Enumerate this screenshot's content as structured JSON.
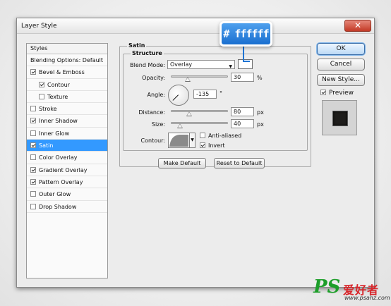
{
  "window": {
    "title": "Layer Style",
    "close_glyph": "✕"
  },
  "styles_list": {
    "header": "Styles",
    "items": [
      {
        "label": "Blending Options: Default",
        "has_checkbox": false,
        "checked": false,
        "indent": false,
        "selected": false
      },
      {
        "label": "Bevel & Emboss",
        "has_checkbox": true,
        "checked": true,
        "indent": false,
        "selected": false
      },
      {
        "label": "Contour",
        "has_checkbox": true,
        "checked": true,
        "indent": true,
        "selected": false
      },
      {
        "label": "Texture",
        "has_checkbox": true,
        "checked": false,
        "indent": true,
        "selected": false
      },
      {
        "label": "Stroke",
        "has_checkbox": true,
        "checked": false,
        "indent": false,
        "selected": false
      },
      {
        "label": "Inner Shadow",
        "has_checkbox": true,
        "checked": true,
        "indent": false,
        "selected": false
      },
      {
        "label": "Inner Glow",
        "has_checkbox": true,
        "checked": false,
        "indent": false,
        "selected": false
      },
      {
        "label": "Satin",
        "has_checkbox": true,
        "checked": true,
        "indent": false,
        "selected": true
      },
      {
        "label": "Color Overlay",
        "has_checkbox": true,
        "checked": false,
        "indent": false,
        "selected": false
      },
      {
        "label": "Gradient Overlay",
        "has_checkbox": true,
        "checked": true,
        "indent": false,
        "selected": false
      },
      {
        "label": "Pattern Overlay",
        "has_checkbox": true,
        "checked": true,
        "indent": false,
        "selected": false
      },
      {
        "label": "Outer Glow",
        "has_checkbox": true,
        "checked": false,
        "indent": false,
        "selected": false
      },
      {
        "label": "Drop Shadow",
        "has_checkbox": true,
        "checked": false,
        "indent": false,
        "selected": false
      }
    ]
  },
  "satin": {
    "group_title": "Satin",
    "structure_title": "Structure",
    "blend_mode": {
      "label": "Blend Mode:",
      "value": "Overlay",
      "color": "#ffffff"
    },
    "opacity": {
      "label": "Opacity:",
      "value": "30",
      "unit": "%",
      "level": 0.3
    },
    "angle": {
      "label": "Angle:",
      "value": "-135",
      "unit": "°"
    },
    "distance": {
      "label": "Distance:",
      "value": "80",
      "unit": "px",
      "level": 0.32
    },
    "size": {
      "label": "Size:",
      "value": "40",
      "unit": "px",
      "level": 0.16
    },
    "contour": {
      "label": "Contour:"
    },
    "anti_aliased": {
      "label": "Anti-aliased",
      "checked": false
    },
    "invert": {
      "label": "Invert",
      "checked": true
    },
    "make_default": "Make Default",
    "reset_default": "Reset to Default"
  },
  "buttons": {
    "ok": "OK",
    "cancel": "Cancel",
    "new_style": "New Style..."
  },
  "preview": {
    "label": "Preview",
    "checked": true
  },
  "callout": {
    "text": "# ffffff",
    "color": "#2a84e4"
  },
  "watermark": {
    "brand": "PS",
    "chinese": "爱好者",
    "url": "www.psahz.com"
  }
}
